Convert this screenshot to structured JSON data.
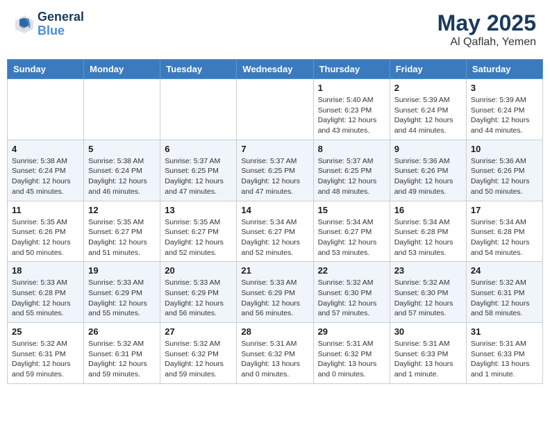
{
  "header": {
    "logo_line1": "General",
    "logo_line2": "Blue",
    "month": "May 2025",
    "location": "Al Qaflah, Yemen"
  },
  "weekdays": [
    "Sunday",
    "Monday",
    "Tuesday",
    "Wednesday",
    "Thursday",
    "Friday",
    "Saturday"
  ],
  "weeks": [
    [
      {
        "day": "",
        "info": ""
      },
      {
        "day": "",
        "info": ""
      },
      {
        "day": "",
        "info": ""
      },
      {
        "day": "",
        "info": ""
      },
      {
        "day": "1",
        "info": "Sunrise: 5:40 AM\nSunset: 6:23 PM\nDaylight: 12 hours\nand 43 minutes."
      },
      {
        "day": "2",
        "info": "Sunrise: 5:39 AM\nSunset: 6:24 PM\nDaylight: 12 hours\nand 44 minutes."
      },
      {
        "day": "3",
        "info": "Sunrise: 5:39 AM\nSunset: 6:24 PM\nDaylight: 12 hours\nand 44 minutes."
      }
    ],
    [
      {
        "day": "4",
        "info": "Sunrise: 5:38 AM\nSunset: 6:24 PM\nDaylight: 12 hours\nand 45 minutes."
      },
      {
        "day": "5",
        "info": "Sunrise: 5:38 AM\nSunset: 6:24 PM\nDaylight: 12 hours\nand 46 minutes."
      },
      {
        "day": "6",
        "info": "Sunrise: 5:37 AM\nSunset: 6:25 PM\nDaylight: 12 hours\nand 47 minutes."
      },
      {
        "day": "7",
        "info": "Sunrise: 5:37 AM\nSunset: 6:25 PM\nDaylight: 12 hours\nand 47 minutes."
      },
      {
        "day": "8",
        "info": "Sunrise: 5:37 AM\nSunset: 6:25 PM\nDaylight: 12 hours\nand 48 minutes."
      },
      {
        "day": "9",
        "info": "Sunrise: 5:36 AM\nSunset: 6:26 PM\nDaylight: 12 hours\nand 49 minutes."
      },
      {
        "day": "10",
        "info": "Sunrise: 5:36 AM\nSunset: 6:26 PM\nDaylight: 12 hours\nand 50 minutes."
      }
    ],
    [
      {
        "day": "11",
        "info": "Sunrise: 5:35 AM\nSunset: 6:26 PM\nDaylight: 12 hours\nand 50 minutes."
      },
      {
        "day": "12",
        "info": "Sunrise: 5:35 AM\nSunset: 6:27 PM\nDaylight: 12 hours\nand 51 minutes."
      },
      {
        "day": "13",
        "info": "Sunrise: 5:35 AM\nSunset: 6:27 PM\nDaylight: 12 hours\nand 52 minutes."
      },
      {
        "day": "14",
        "info": "Sunrise: 5:34 AM\nSunset: 6:27 PM\nDaylight: 12 hours\nand 52 minutes."
      },
      {
        "day": "15",
        "info": "Sunrise: 5:34 AM\nSunset: 6:27 PM\nDaylight: 12 hours\nand 53 minutes."
      },
      {
        "day": "16",
        "info": "Sunrise: 5:34 AM\nSunset: 6:28 PM\nDaylight: 12 hours\nand 53 minutes."
      },
      {
        "day": "17",
        "info": "Sunrise: 5:34 AM\nSunset: 6:28 PM\nDaylight: 12 hours\nand 54 minutes."
      }
    ],
    [
      {
        "day": "18",
        "info": "Sunrise: 5:33 AM\nSunset: 6:28 PM\nDaylight: 12 hours\nand 55 minutes."
      },
      {
        "day": "19",
        "info": "Sunrise: 5:33 AM\nSunset: 6:29 PM\nDaylight: 12 hours\nand 55 minutes."
      },
      {
        "day": "20",
        "info": "Sunrise: 5:33 AM\nSunset: 6:29 PM\nDaylight: 12 hours\nand 56 minutes."
      },
      {
        "day": "21",
        "info": "Sunrise: 5:33 AM\nSunset: 6:29 PM\nDaylight: 12 hours\nand 56 minutes."
      },
      {
        "day": "22",
        "info": "Sunrise: 5:32 AM\nSunset: 6:30 PM\nDaylight: 12 hours\nand 57 minutes."
      },
      {
        "day": "23",
        "info": "Sunrise: 5:32 AM\nSunset: 6:30 PM\nDaylight: 12 hours\nand 57 minutes."
      },
      {
        "day": "24",
        "info": "Sunrise: 5:32 AM\nSunset: 6:31 PM\nDaylight: 12 hours\nand 58 minutes."
      }
    ],
    [
      {
        "day": "25",
        "info": "Sunrise: 5:32 AM\nSunset: 6:31 PM\nDaylight: 12 hours\nand 59 minutes."
      },
      {
        "day": "26",
        "info": "Sunrise: 5:32 AM\nSunset: 6:31 PM\nDaylight: 12 hours\nand 59 minutes."
      },
      {
        "day": "27",
        "info": "Sunrise: 5:32 AM\nSunset: 6:32 PM\nDaylight: 12 hours\nand 59 minutes."
      },
      {
        "day": "28",
        "info": "Sunrise: 5:31 AM\nSunset: 6:32 PM\nDaylight: 13 hours\nand 0 minutes."
      },
      {
        "day": "29",
        "info": "Sunrise: 5:31 AM\nSunset: 6:32 PM\nDaylight: 13 hours\nand 0 minutes."
      },
      {
        "day": "30",
        "info": "Sunrise: 5:31 AM\nSunset: 6:33 PM\nDaylight: 13 hours\nand 1 minute."
      },
      {
        "day": "31",
        "info": "Sunrise: 5:31 AM\nSunset: 6:33 PM\nDaylight: 13 hours\nand 1 minute."
      }
    ]
  ]
}
